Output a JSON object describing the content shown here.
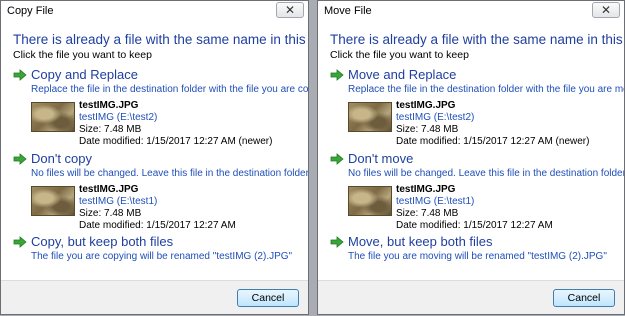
{
  "copy_dialog": {
    "title": "Copy File",
    "heading": "There is already a file with the same name in this location.",
    "subheading": "Click the file you want to keep",
    "option_replace": {
      "title": "Copy and Replace",
      "description": "Replace the file in the destination folder with the file you are copying:",
      "file_name": "testIMG.JPG",
      "file_location": "testIMG (E:\\test2)",
      "file_size": "Size: 7.48 MB",
      "file_date": "Date modified: 1/15/2017 12:27 AM (newer)"
    },
    "option_skip": {
      "title": "Don't copy",
      "description": "No files will be changed. Leave this file in the destination folder:",
      "file_name": "testIMG.JPG",
      "file_location": "testIMG (E:\\test1)",
      "file_size": "Size: 7.48 MB",
      "file_date": "Date modified: 1/15/2017 12:27 AM"
    },
    "option_keep_both": {
      "title": "Copy, but keep both files",
      "description": "The file you are copying will be renamed \"testIMG (2).JPG\""
    },
    "cancel_label": "Cancel",
    "close_glyph": "✕"
  },
  "move_dialog": {
    "title": "Move File",
    "heading": "There is already a file with the same name in this location.",
    "subheading": "Click the file you want to keep",
    "option_replace": {
      "title": "Move and Replace",
      "description": "Replace the file in the destination folder with the file you are moving:",
      "file_name": "testIMG.JPG",
      "file_location": "testIMG (E:\\test2)",
      "file_size": "Size: 7.48 MB",
      "file_date": "Date modified: 1/15/2017 12:27 AM (newer)"
    },
    "option_skip": {
      "title": "Don't move",
      "description": "No files will be changed. Leave this file in the destination folder:",
      "file_name": "testIMG.JPG",
      "file_location": "testIMG (E:\\test1)",
      "file_size": "Size: 7.48 MB",
      "file_date": "Date modified: 1/15/2017 12:27 AM"
    },
    "option_keep_both": {
      "title": "Move, but keep both files",
      "description": "The file you are moving will be renamed \"testIMG (2).JPG\""
    },
    "cancel_label": "Cancel",
    "close_glyph": "✕"
  },
  "icons": {
    "option_arrow": "green-arrow-icon",
    "thumbnail": "image-thumbnail"
  },
  "colors": {
    "link_blue": "#1f3fa0",
    "arrow_green": "#3aa63a",
    "button_border": "#3c7fb1"
  }
}
